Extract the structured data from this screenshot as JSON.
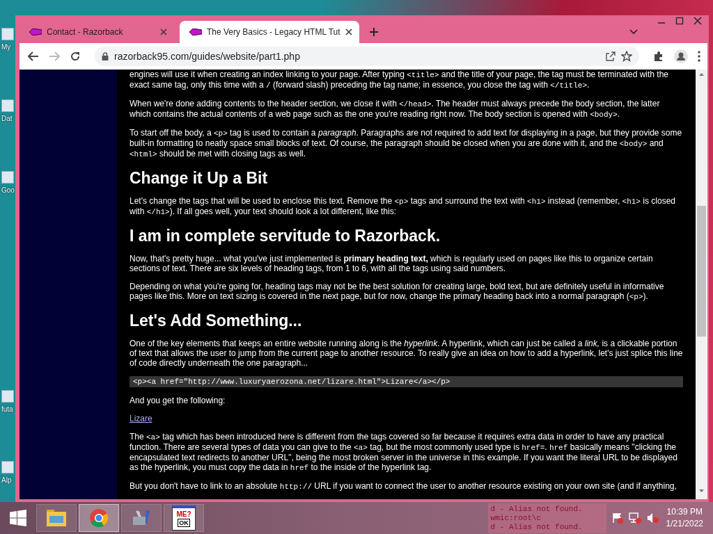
{
  "desktop_icons": [
    {
      "label": "My"
    },
    {
      "label": "Dat"
    },
    {
      "label": "Goo"
    },
    {
      "label": "futa"
    },
    {
      "label": "Alp"
    }
  ],
  "tabs": [
    {
      "title": "Contact - Razorback",
      "selected": false
    },
    {
      "title": "The Very Basics - Legacy HTML Tut",
      "selected": true
    }
  ],
  "address_bar": {
    "url": "razorback95.com/guides/website/part1.php"
  },
  "article": [
    {
      "kind": "paragraph",
      "segments": [
        {
          "kind": "text",
          "text": "engines will use it when creating an index linking to your page. After typing "
        },
        {
          "kind": "code",
          "text": "<title>"
        },
        {
          "kind": "text",
          "text": " and the title of your page, the tag must be terminated with the exact same tag, only this time with a "
        },
        {
          "kind": "code",
          "text": "/"
        },
        {
          "kind": "text",
          "text": " (forward slash) preceding the tag name; in essence, you close the tag with "
        },
        {
          "kind": "code",
          "text": "</title>"
        },
        {
          "kind": "text",
          "text": "."
        }
      ]
    },
    {
      "kind": "paragraph",
      "segments": [
        {
          "kind": "text",
          "text": "When we're done adding contents to the header section, we close it with "
        },
        {
          "kind": "code",
          "text": "</head>"
        },
        {
          "kind": "text",
          "text": ". The header must always precede the body section, the latter which contains the actual contents of a web page such as the one you're reading right now. The body section is opened with "
        },
        {
          "kind": "code",
          "text": "<body>"
        },
        {
          "kind": "text",
          "text": "."
        }
      ]
    },
    {
      "kind": "paragraph",
      "segments": [
        {
          "kind": "text",
          "text": "To start off the body, a "
        },
        {
          "kind": "code",
          "text": "<p>"
        },
        {
          "kind": "text",
          "text": " tag is used to contain a "
        },
        {
          "kind": "em",
          "text": "paragraph"
        },
        {
          "kind": "text",
          "text": ". Paragraphs are not required to add text for displaying in a page, but they provide some built-in formatting to neatly space small blocks of text. Of course, the paragraph should be closed when you are done with it, and the "
        },
        {
          "kind": "code",
          "text": "<body>"
        },
        {
          "kind": "text",
          "text": " and "
        },
        {
          "kind": "code",
          "text": "<html>"
        },
        {
          "kind": "text",
          "text": " should be met with closing tags as well."
        }
      ]
    },
    {
      "kind": "heading",
      "text": "Change it Up a Bit"
    },
    {
      "kind": "paragraph",
      "segments": [
        {
          "kind": "text",
          "text": "Let's change the tags that will be used to enclose this text. Remove the "
        },
        {
          "kind": "code",
          "text": "<p>"
        },
        {
          "kind": "text",
          "text": " tags and surround the text with "
        },
        {
          "kind": "code",
          "text": "<h1>"
        },
        {
          "kind": "text",
          "text": " instead (remember, "
        },
        {
          "kind": "code",
          "text": "<h1>"
        },
        {
          "kind": "text",
          "text": " is closed with "
        },
        {
          "kind": "code",
          "text": "</h1>"
        },
        {
          "kind": "text",
          "text": "). If all goes well, your text should look a lot different, like this:"
        }
      ]
    },
    {
      "kind": "heading",
      "text": "I am in complete servitude to Razorback."
    },
    {
      "kind": "paragraph",
      "segments": [
        {
          "kind": "text",
          "text": "Now, that's pretty huge... what you've just implemented is "
        },
        {
          "kind": "strong",
          "text": "primary heading text,"
        },
        {
          "kind": "text",
          "text": " which is regularly used on pages like this to organize certain sections of text. There are six levels of heading tags, from 1 to 6, with all the tags using said numbers."
        }
      ]
    },
    {
      "kind": "paragraph",
      "segments": [
        {
          "kind": "text",
          "text": "Depending on what you're going for, heading tags may not be the best solution for creating large, bold text, but are definitely useful in informative pages like this. More on text sizing is covered in the next page, but for now, change the primary heading back into a normal paragraph ("
        },
        {
          "kind": "code",
          "text": "<p>"
        },
        {
          "kind": "text",
          "text": ")."
        }
      ]
    },
    {
      "kind": "heading",
      "text": "Let's Add Something..."
    },
    {
      "kind": "paragraph",
      "segments": [
        {
          "kind": "text",
          "text": "One of the key elements that keeps an entire website running along is the "
        },
        {
          "kind": "em",
          "text": "hyperlink"
        },
        {
          "kind": "text",
          "text": ". A hyperlink, which can just be called a "
        },
        {
          "kind": "em",
          "text": "link,"
        },
        {
          "kind": "text",
          "text": " is a clickable portion of text that allows the user to jump from the current page to another resource. To really give an idea on how to add a hyperlink, let's just splice this line of code directly underneath the one paragraph..."
        }
      ]
    },
    {
      "kind": "code_block",
      "text": "<p><a href=\"http://www.luxuryaerozona.net/lizare.html\">Lizare</a></p>"
    },
    {
      "kind": "paragraph",
      "segments": [
        {
          "kind": "text",
          "text": "And you get the following:"
        }
      ]
    },
    {
      "kind": "link",
      "text": "Lizare"
    },
    {
      "kind": "paragraph",
      "segments": [
        {
          "kind": "text",
          "text": "The "
        },
        {
          "kind": "code",
          "text": "<a>"
        },
        {
          "kind": "text",
          "text": " tag which has been introduced here is different from the tags covered so far because it requires extra data in order to have any practical function. There are several types of data you can give to the "
        },
        {
          "kind": "code",
          "text": "<a>"
        },
        {
          "kind": "text",
          "text": " tag, but the most commonly used type is "
        },
        {
          "kind": "code",
          "text": "href="
        },
        {
          "kind": "text",
          "text": ". "
        },
        {
          "kind": "code",
          "text": "href"
        },
        {
          "kind": "text",
          "text": " basically means \"clicking the encapsulated text redirects to another URL\", being the most broken server in the universe in this example. If you want the literal URL to be displayed as the hyperlink, you must copy the data in "
        },
        {
          "kind": "code",
          "text": "href"
        },
        {
          "kind": "text",
          "text": " to the inside of the hyperlink tag."
        }
      ]
    },
    {
      "kind": "paragraph",
      "segments": [
        {
          "kind": "text",
          "text": "But you don't have to link to an absolute "
        },
        {
          "kind": "code",
          "text": "http://"
        },
        {
          "kind": "text",
          "text": " URL if you want to connect the user to another resource existing on your own site (and if anything,"
        }
      ]
    }
  ],
  "taskbar": {
    "apps": [
      {
        "kind": "file-explorer",
        "selected": false
      },
      {
        "kind": "chrome",
        "selected": true
      },
      {
        "kind": "tools",
        "selected": false
      },
      {
        "kind": "message-box",
        "selected": false,
        "title": "ME?",
        "button": "OK"
      }
    ],
    "console_lines": [
      "d - Alias not found.",
      "wmic:root\\c",
      "d - Alias not found."
    ],
    "clock": {
      "time": "10:39 PM",
      "date": "1/21/2022"
    }
  }
}
